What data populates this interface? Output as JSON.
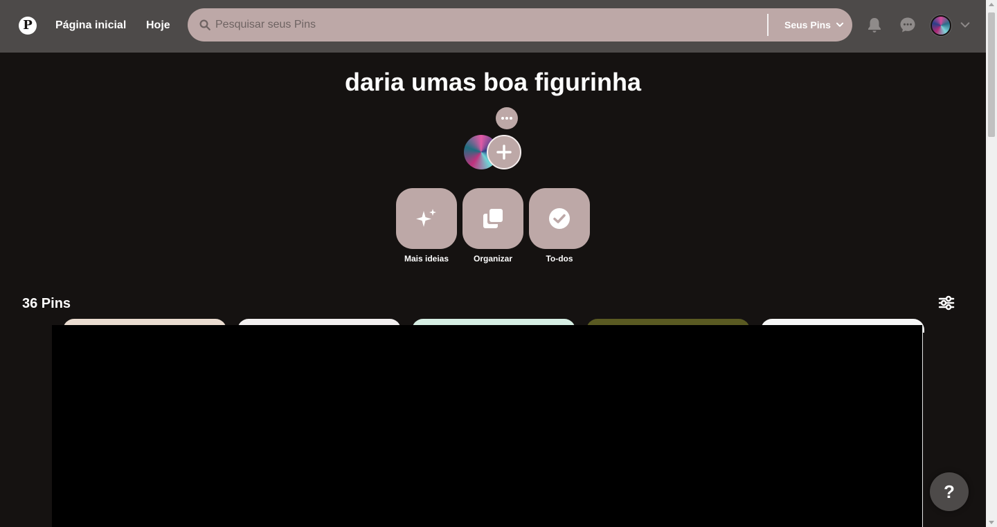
{
  "header": {
    "logo_icon": "pinterest-logo",
    "nav": {
      "home": "Página inicial",
      "today": "Hoje"
    },
    "search": {
      "placeholder": "Pesquisar seus Pins",
      "value": "",
      "scope": "Seus Pins"
    },
    "icons": [
      "bell-icon",
      "chat-icon",
      "avatar",
      "chevron-down-icon"
    ]
  },
  "board": {
    "title": "daria umas boa figurinha",
    "actions": [
      {
        "label": "Mais ideias",
        "icon": "sparkle-icon"
      },
      {
        "label": "Organizar",
        "icon": "organize-icon"
      },
      {
        "label": "To-dos",
        "icon": "check-circle-icon"
      }
    ],
    "pin_count": "36 Pins"
  },
  "pins": [
    {
      "color": "#eadcd0"
    },
    {
      "color": "#f2efef"
    },
    {
      "color": "#d6eee3"
    },
    {
      "color": "#5a5a22"
    },
    {
      "color": "#f6f6f6"
    }
  ],
  "help_label": "?",
  "colors": {
    "accent": "#bda8a7",
    "header_bg": "#4d4a49",
    "page_bg": "#151211"
  }
}
